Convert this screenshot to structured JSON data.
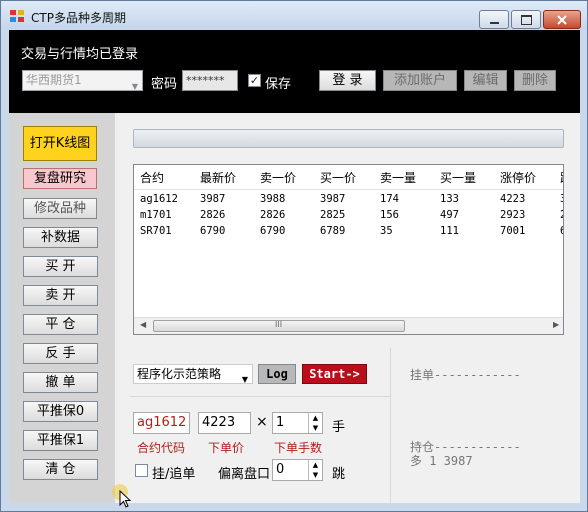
{
  "window": {
    "title": "CTP多品种多周期"
  },
  "header": {
    "status_text": "交易与行情均已登录",
    "broker_selected": "华西期货1",
    "password_label": "密码",
    "password_value": "*******",
    "save_label": "保存",
    "save_checked": "✓",
    "login_label": "登 录",
    "add_account_label": "添加账户",
    "edit_label": "编辑",
    "delete_label": "删除"
  },
  "sidebar": {
    "buttons": [
      "打开K线图",
      "复盘研究",
      "修改品种",
      "补数据",
      "买 开",
      "卖 开",
      "平 仓",
      "反 手",
      "撤 单",
      "平推保0",
      "平推保1",
      "清 仓"
    ]
  },
  "grid": {
    "columns": [
      "合约",
      "最新价",
      "卖一价",
      "买一价",
      "卖一量",
      "买一量",
      "涨停价",
      "跌"
    ],
    "rows": [
      [
        "ag1612",
        "3987",
        "3988",
        "3987",
        "174",
        "133",
        "4223",
        "3"
      ],
      [
        "m1701",
        "2826",
        "2826",
        "2825",
        "156",
        "497",
        "2923",
        "2"
      ],
      [
        "SR701",
        "6790",
        "6790",
        "6789",
        "35",
        "111",
        "7001",
        "6"
      ]
    ],
    "scroll_grip": "III"
  },
  "strategy": {
    "selected": "程序化示范策略",
    "log_label": "Log",
    "start_label": "Start->"
  },
  "order": {
    "contract_value": "ag1612",
    "price_value": "4223",
    "times_symbol": "×",
    "qty_value": "1",
    "qty_unit": "手",
    "contract_label": "合约代码",
    "price_label": "下单价",
    "qty_label": "下单手数",
    "chase_label": "挂/追单",
    "offset_label": "偏离盘口",
    "offset_value": "0",
    "offset_unit": "跳"
  },
  "right_panel": {
    "pending_text": "挂单------------",
    "position_title": "持仓------------",
    "position_line": "多 1 3987"
  }
}
